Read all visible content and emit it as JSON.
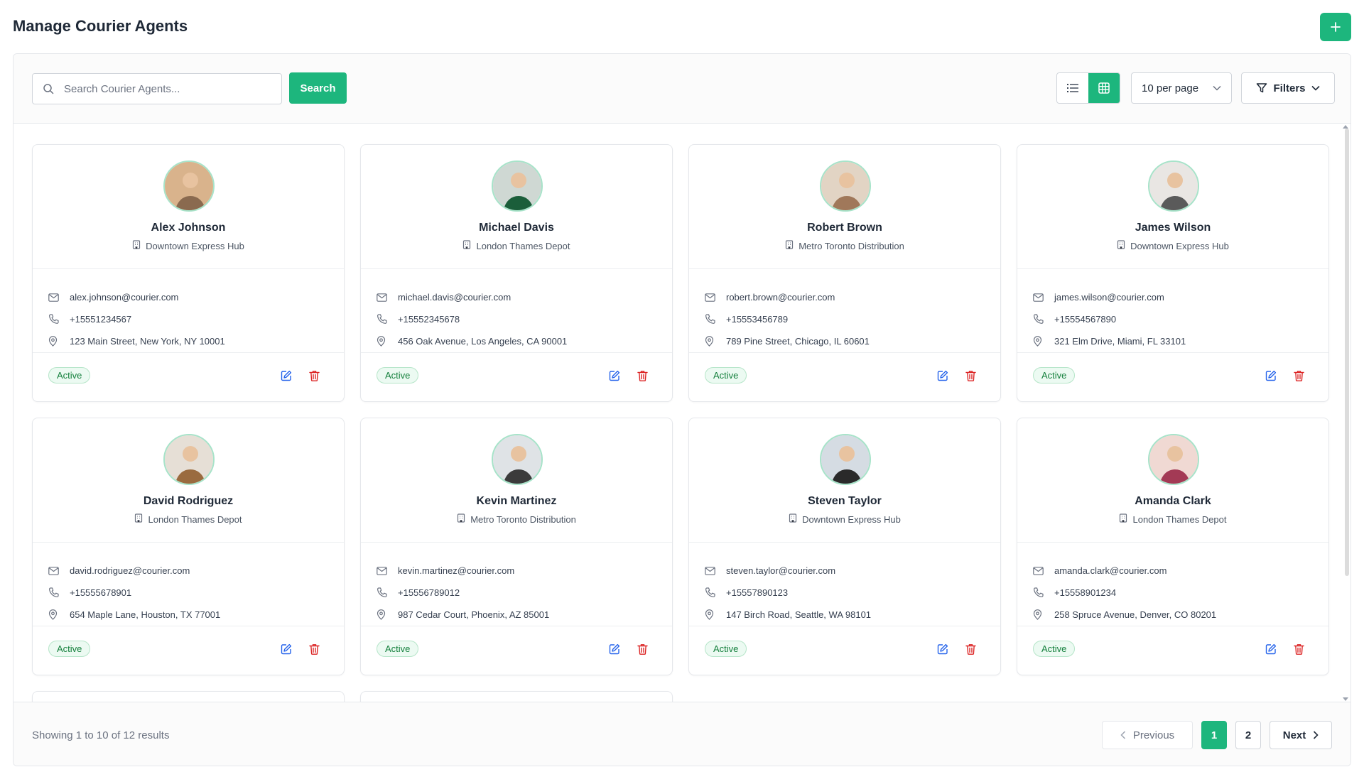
{
  "header": {
    "title": "Manage Courier Agents",
    "add_label": "+"
  },
  "toolbar": {
    "search_placeholder": "Search Courier Agents...",
    "search_button": "Search",
    "per_page": "10 per page",
    "filters": "Filters",
    "view_mode": "grid"
  },
  "colors": {
    "accent": "#1db67d",
    "danger": "#dc2626",
    "edit": "#2563eb",
    "active_badge": "#15803d"
  },
  "agents": [
    {
      "name": "Alex Johnson",
      "depot": "Downtown Express Hub",
      "email": "alex.johnson@courier.com",
      "phone": "+15551234567",
      "address": "123 Main Street, New York, NY 10001",
      "status": "Active"
    },
    {
      "name": "Michael Davis",
      "depot": "London Thames Depot",
      "email": "michael.davis@courier.com",
      "phone": "+15552345678",
      "address": "456 Oak Avenue, Los Angeles, CA 90001",
      "status": "Active"
    },
    {
      "name": "Robert Brown",
      "depot": "Metro Toronto Distribution",
      "email": "robert.brown@courier.com",
      "phone": "+15553456789",
      "address": "789 Pine Street, Chicago, IL 60601",
      "status": "Active"
    },
    {
      "name": "James Wilson",
      "depot": "Downtown Express Hub",
      "email": "james.wilson@courier.com",
      "phone": "+15554567890",
      "address": "321 Elm Drive, Miami, FL 33101",
      "status": "Active"
    },
    {
      "name": "David Rodriguez",
      "depot": "London Thames Depot",
      "email": "david.rodriguez@courier.com",
      "phone": "+15555678901",
      "address": "654 Maple Lane, Houston, TX 77001",
      "status": "Active"
    },
    {
      "name": "Kevin Martinez",
      "depot": "Metro Toronto Distribution",
      "email": "kevin.martinez@courier.com",
      "phone": "+15556789012",
      "address": "987 Cedar Court, Phoenix, AZ 85001",
      "status": "Active"
    },
    {
      "name": "Steven Taylor",
      "depot": "Downtown Express Hub",
      "email": "steven.taylor@courier.com",
      "phone": "+15557890123",
      "address": "147 Birch Road, Seattle, WA 98101",
      "status": "Active"
    },
    {
      "name": "Amanda Clark",
      "depot": "London Thames Depot",
      "email": "amanda.clark@courier.com",
      "phone": "+15558901234",
      "address": "258 Spruce Avenue, Denver, CO 80201",
      "status": "Active"
    }
  ],
  "footer": {
    "showing": "Showing 1 to 10 of 12 results",
    "previous": "Previous",
    "pages": [
      "1",
      "2"
    ],
    "current_page": "1",
    "next": "Next"
  }
}
